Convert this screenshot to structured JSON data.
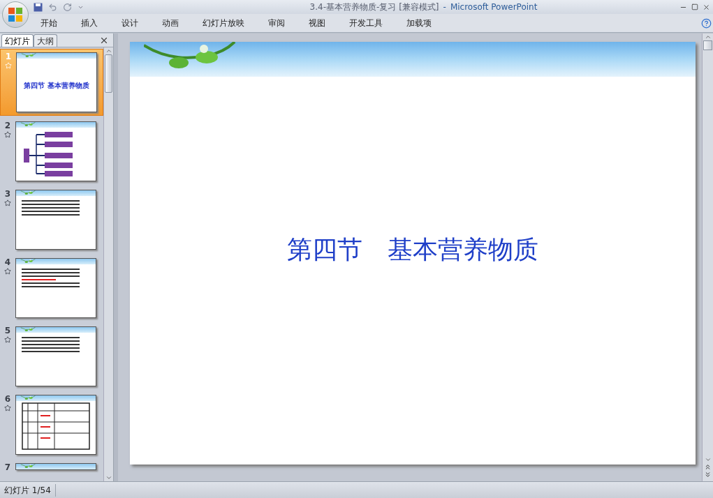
{
  "window": {
    "title": "3.4-基本营养物质-复习 [兼容模式]",
    "separator": "-",
    "app": "Microsoft PowerPoint"
  },
  "ribbon_tabs": [
    {
      "label": "开始",
      "selected": false
    },
    {
      "label": "插入",
      "selected": false
    },
    {
      "label": "设计",
      "selected": false
    },
    {
      "label": "动画",
      "selected": false
    },
    {
      "label": "幻灯片放映",
      "selected": false
    },
    {
      "label": "审阅",
      "selected": false
    },
    {
      "label": "视图",
      "selected": false
    },
    {
      "label": "开发工具",
      "selected": false
    },
    {
      "label": "加载项",
      "selected": false
    }
  ],
  "pane_tabs": [
    {
      "label": "幻灯片",
      "selected": true
    },
    {
      "label": "大纲",
      "selected": false
    }
  ],
  "slides": [
    {
      "number": "1",
      "kind": "title",
      "selected": true,
      "title": "第四节 基本营养物质"
    },
    {
      "number": "2",
      "kind": "diagram",
      "selected": false
    },
    {
      "number": "3",
      "kind": "text",
      "selected": false
    },
    {
      "number": "4",
      "kind": "text",
      "selected": false
    },
    {
      "number": "5",
      "kind": "text",
      "selected": false
    },
    {
      "number": "6",
      "kind": "table",
      "selected": false
    },
    {
      "number": "7",
      "kind": "partial",
      "selected": false
    }
  ],
  "slide": {
    "title": "第四节　基本营养物质"
  },
  "status_bar": {
    "slide_counter": "幻灯片 1/54"
  }
}
